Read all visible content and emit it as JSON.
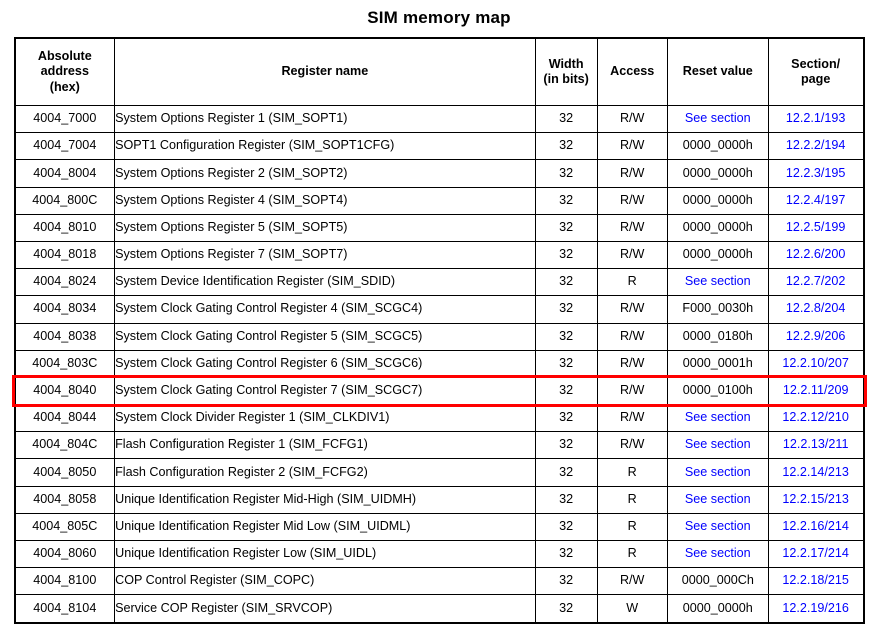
{
  "page": {
    "title": "SIM memory map"
  },
  "colors": {
    "link": "#0000FF",
    "highlight": "#FF0000",
    "border": "#000000",
    "text": "#000000",
    "background": "#FFFFFF"
  },
  "table": {
    "headers": [
      {
        "line1": "Absolute",
        "line2": "address",
        "line3": "(hex)"
      },
      {
        "line1": "Register name"
      },
      {
        "line1": "Width",
        "line2": "(in bits)"
      },
      {
        "line1": "Access"
      },
      {
        "line1": "Reset value"
      },
      {
        "line1": "Section/",
        "line2": "page"
      }
    ],
    "highlighted_row_index": 10,
    "rows": [
      {
        "address": "4004_7000",
        "name": "System Options Register 1 (SIM_SOPT1)",
        "width": "32",
        "access": "R/W",
        "reset": "See section",
        "reset_is_link": true,
        "section": "12.2.1/193"
      },
      {
        "address": "4004_7004",
        "name": "SOPT1 Configuration Register (SIM_SOPT1CFG)",
        "width": "32",
        "access": "R/W",
        "reset": "0000_0000h",
        "reset_is_link": false,
        "section": "12.2.2/194"
      },
      {
        "address": "4004_8004",
        "name": "System Options Register 2 (SIM_SOPT2)",
        "width": "32",
        "access": "R/W",
        "reset": "0000_0000h",
        "reset_is_link": false,
        "section": "12.2.3/195"
      },
      {
        "address": "4004_800C",
        "name": "System Options Register 4 (SIM_SOPT4)",
        "width": "32",
        "access": "R/W",
        "reset": "0000_0000h",
        "reset_is_link": false,
        "section": "12.2.4/197"
      },
      {
        "address": "4004_8010",
        "name": "System Options Register 5 (SIM_SOPT5)",
        "width": "32",
        "access": "R/W",
        "reset": "0000_0000h",
        "reset_is_link": false,
        "section": "12.2.5/199"
      },
      {
        "address": "4004_8018",
        "name": "System Options Register 7 (SIM_SOPT7)",
        "width": "32",
        "access": "R/W",
        "reset": "0000_0000h",
        "reset_is_link": false,
        "section": "12.2.6/200"
      },
      {
        "address": "4004_8024",
        "name": "System Device Identification Register (SIM_SDID)",
        "width": "32",
        "access": "R",
        "reset": "See section",
        "reset_is_link": true,
        "section": "12.2.7/202"
      },
      {
        "address": "4004_8034",
        "name": "System Clock Gating Control Register 4 (SIM_SCGC4)",
        "width": "32",
        "access": "R/W",
        "reset": "F000_0030h",
        "reset_is_link": false,
        "section": "12.2.8/204"
      },
      {
        "address": "4004_8038",
        "name": "System Clock Gating Control Register 5 (SIM_SCGC5)",
        "width": "32",
        "access": "R/W",
        "reset": "0000_0180h",
        "reset_is_link": false,
        "section": "12.2.9/206"
      },
      {
        "address": "4004_803C",
        "name": "System Clock Gating Control Register 6 (SIM_SCGC6)",
        "width": "32",
        "access": "R/W",
        "reset": "0000_0001h",
        "reset_is_link": false,
        "section": "12.2.10/207"
      },
      {
        "address": "4004_8040",
        "name": "System Clock Gating Control Register 7 (SIM_SCGC7)",
        "width": "32",
        "access": "R/W",
        "reset": "0000_0100h",
        "reset_is_link": false,
        "section": "12.2.11/209"
      },
      {
        "address": "4004_8044",
        "name": "System Clock Divider Register 1 (SIM_CLKDIV1)",
        "width": "32",
        "access": "R/W",
        "reset": "See section",
        "reset_is_link": true,
        "section": "12.2.12/210"
      },
      {
        "address": "4004_804C",
        "name": "Flash Configuration Register 1 (SIM_FCFG1)",
        "width": "32",
        "access": "R/W",
        "reset": "See section",
        "reset_is_link": true,
        "section": "12.2.13/211"
      },
      {
        "address": "4004_8050",
        "name": "Flash Configuration Register 2 (SIM_FCFG2)",
        "width": "32",
        "access": "R",
        "reset": "See section",
        "reset_is_link": true,
        "section": "12.2.14/213"
      },
      {
        "address": "4004_8058",
        "name": "Unique Identification Register Mid-High (SIM_UIDMH)",
        "width": "32",
        "access": "R",
        "reset": "See section",
        "reset_is_link": true,
        "section": "12.2.15/213"
      },
      {
        "address": "4004_805C",
        "name": "Unique Identification Register Mid Low (SIM_UIDML)",
        "width": "32",
        "access": "R",
        "reset": "See section",
        "reset_is_link": true,
        "section": "12.2.16/214"
      },
      {
        "address": "4004_8060",
        "name": "Unique Identification Register Low (SIM_UIDL)",
        "width": "32",
        "access": "R",
        "reset": "See section",
        "reset_is_link": true,
        "section": "12.2.17/214"
      },
      {
        "address": "4004_8100",
        "name": "COP Control Register (SIM_COPC)",
        "width": "32",
        "access": "R/W",
        "reset": "0000_000Ch",
        "reset_is_link": false,
        "section": "12.2.18/215"
      },
      {
        "address": "4004_8104",
        "name": "Service COP Register (SIM_SRVCOP)",
        "width": "32",
        "access": "W",
        "reset": "0000_0000h",
        "reset_is_link": false,
        "section": "12.2.19/216"
      }
    ]
  }
}
